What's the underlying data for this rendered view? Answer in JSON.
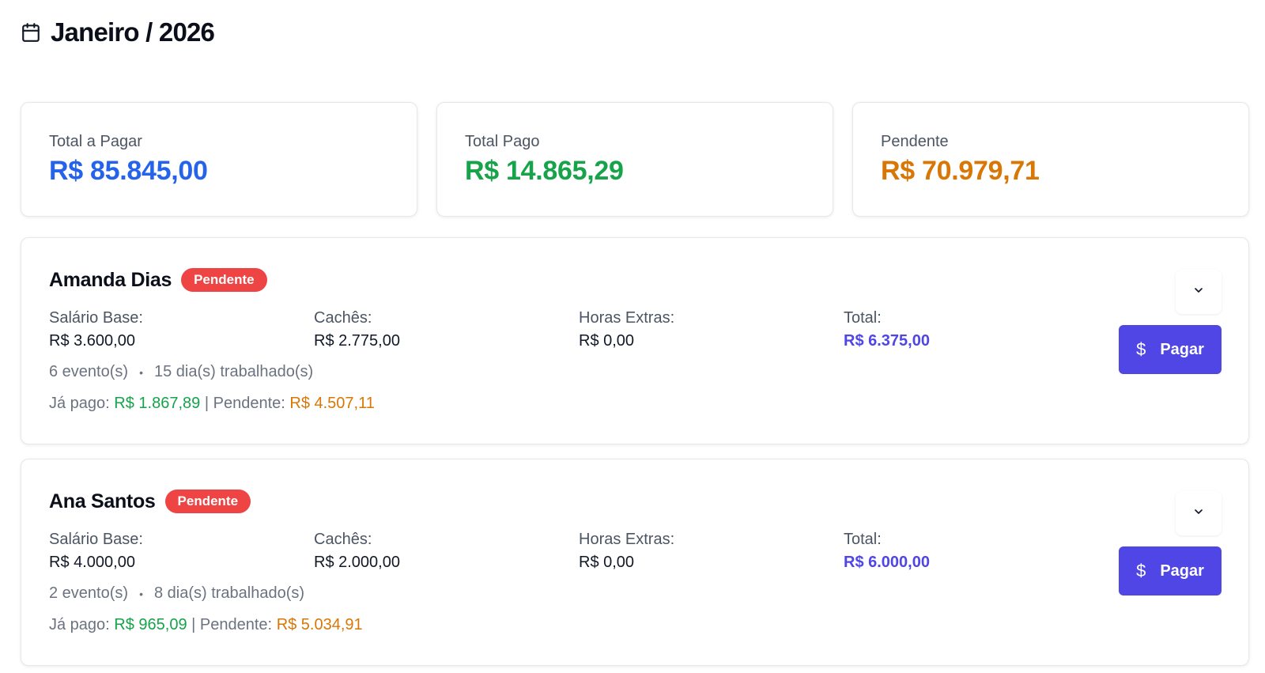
{
  "header": {
    "icon": "calendar-icon",
    "title": "Janeiro / 2026"
  },
  "summary": [
    {
      "label": "Total a Pagar",
      "value": "R$ 85.845,00",
      "color": "#2563eb"
    },
    {
      "label": "Total Pago",
      "value": "R$ 14.865,29",
      "color": "#16a34a"
    },
    {
      "label": "Pendente",
      "value": "R$ 70.979,71",
      "color": "#d97706"
    }
  ],
  "employees": [
    {
      "name": "Amanda Dias",
      "status": "Pendente",
      "salario_label": "Salário Base:",
      "salario": "R$ 3.600,00",
      "caches_label": "Cachês:",
      "caches": "R$ 2.775,00",
      "horas_label": "Horas Extras:",
      "horas": "R$ 0,00",
      "total_label": "Total:",
      "total": "R$ 6.375,00",
      "eventos": "6 evento(s)",
      "dias": "15 dia(s) trabalhado(s)",
      "pago_label": "Já pago:",
      "pago": "R$ 1.867,89",
      "separator": "|",
      "pendente_label": "Pendente:",
      "pendente": "R$ 4.507,11",
      "pay_label": "Pagar"
    },
    {
      "name": "Ana Santos",
      "status": "Pendente",
      "salario_label": "Salário Base:",
      "salario": "R$ 4.000,00",
      "caches_label": "Cachês:",
      "caches": "R$ 2.000,00",
      "horas_label": "Horas Extras:",
      "horas": "R$ 0,00",
      "total_label": "Total:",
      "total": "R$ 6.000,00",
      "eventos": "2 evento(s)",
      "dias": "8 dia(s) trabalhado(s)",
      "pago_label": "Já pago:",
      "pago": "R$ 965,09",
      "separator": "|",
      "pendente_label": "Pendente:",
      "pendente": "R$ 5.034,91",
      "pay_label": "Pagar"
    }
  ],
  "colors": {
    "badge": "#ef4444",
    "button": "#4f46e5",
    "paid": "#16a34a",
    "pending": "#d97706",
    "total": "#4f46e5"
  }
}
